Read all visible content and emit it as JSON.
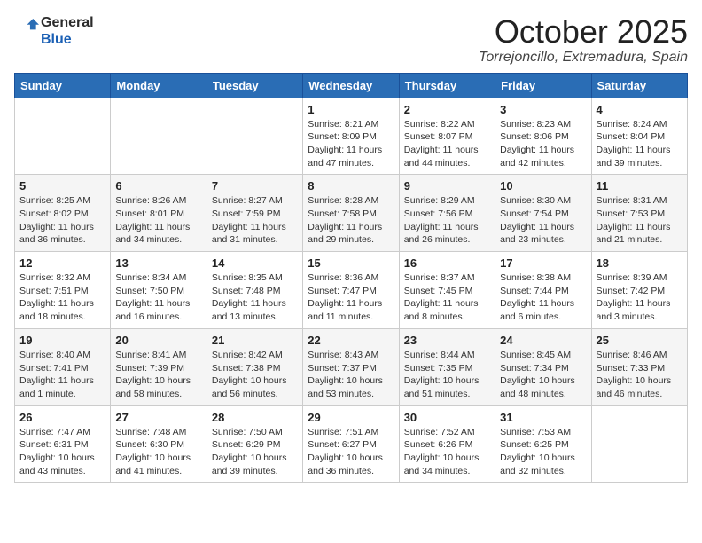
{
  "header": {
    "logo_text_general": "General",
    "logo_text_blue": "Blue",
    "month": "October 2025",
    "location": "Torrejoncillo, Extremadura, Spain"
  },
  "weekdays": [
    "Sunday",
    "Monday",
    "Tuesday",
    "Wednesday",
    "Thursday",
    "Friday",
    "Saturday"
  ],
  "weeks": [
    [
      {
        "day": "",
        "info": ""
      },
      {
        "day": "",
        "info": ""
      },
      {
        "day": "",
        "info": ""
      },
      {
        "day": "1",
        "info": "Sunrise: 8:21 AM\nSunset: 8:09 PM\nDaylight: 11 hours and 47 minutes."
      },
      {
        "day": "2",
        "info": "Sunrise: 8:22 AM\nSunset: 8:07 PM\nDaylight: 11 hours and 44 minutes."
      },
      {
        "day": "3",
        "info": "Sunrise: 8:23 AM\nSunset: 8:06 PM\nDaylight: 11 hours and 42 minutes."
      },
      {
        "day": "4",
        "info": "Sunrise: 8:24 AM\nSunset: 8:04 PM\nDaylight: 11 hours and 39 minutes."
      }
    ],
    [
      {
        "day": "5",
        "info": "Sunrise: 8:25 AM\nSunset: 8:02 PM\nDaylight: 11 hours and 36 minutes."
      },
      {
        "day": "6",
        "info": "Sunrise: 8:26 AM\nSunset: 8:01 PM\nDaylight: 11 hours and 34 minutes."
      },
      {
        "day": "7",
        "info": "Sunrise: 8:27 AM\nSunset: 7:59 PM\nDaylight: 11 hours and 31 minutes."
      },
      {
        "day": "8",
        "info": "Sunrise: 8:28 AM\nSunset: 7:58 PM\nDaylight: 11 hours and 29 minutes."
      },
      {
        "day": "9",
        "info": "Sunrise: 8:29 AM\nSunset: 7:56 PM\nDaylight: 11 hours and 26 minutes."
      },
      {
        "day": "10",
        "info": "Sunrise: 8:30 AM\nSunset: 7:54 PM\nDaylight: 11 hours and 23 minutes."
      },
      {
        "day": "11",
        "info": "Sunrise: 8:31 AM\nSunset: 7:53 PM\nDaylight: 11 hours and 21 minutes."
      }
    ],
    [
      {
        "day": "12",
        "info": "Sunrise: 8:32 AM\nSunset: 7:51 PM\nDaylight: 11 hours and 18 minutes."
      },
      {
        "day": "13",
        "info": "Sunrise: 8:34 AM\nSunset: 7:50 PM\nDaylight: 11 hours and 16 minutes."
      },
      {
        "day": "14",
        "info": "Sunrise: 8:35 AM\nSunset: 7:48 PM\nDaylight: 11 hours and 13 minutes."
      },
      {
        "day": "15",
        "info": "Sunrise: 8:36 AM\nSunset: 7:47 PM\nDaylight: 11 hours and 11 minutes."
      },
      {
        "day": "16",
        "info": "Sunrise: 8:37 AM\nSunset: 7:45 PM\nDaylight: 11 hours and 8 minutes."
      },
      {
        "day": "17",
        "info": "Sunrise: 8:38 AM\nSunset: 7:44 PM\nDaylight: 11 hours and 6 minutes."
      },
      {
        "day": "18",
        "info": "Sunrise: 8:39 AM\nSunset: 7:42 PM\nDaylight: 11 hours and 3 minutes."
      }
    ],
    [
      {
        "day": "19",
        "info": "Sunrise: 8:40 AM\nSunset: 7:41 PM\nDaylight: 11 hours and 1 minute."
      },
      {
        "day": "20",
        "info": "Sunrise: 8:41 AM\nSunset: 7:39 PM\nDaylight: 10 hours and 58 minutes."
      },
      {
        "day": "21",
        "info": "Sunrise: 8:42 AM\nSunset: 7:38 PM\nDaylight: 10 hours and 56 minutes."
      },
      {
        "day": "22",
        "info": "Sunrise: 8:43 AM\nSunset: 7:37 PM\nDaylight: 10 hours and 53 minutes."
      },
      {
        "day": "23",
        "info": "Sunrise: 8:44 AM\nSunset: 7:35 PM\nDaylight: 10 hours and 51 minutes."
      },
      {
        "day": "24",
        "info": "Sunrise: 8:45 AM\nSunset: 7:34 PM\nDaylight: 10 hours and 48 minutes."
      },
      {
        "day": "25",
        "info": "Sunrise: 8:46 AM\nSunset: 7:33 PM\nDaylight: 10 hours and 46 minutes."
      }
    ],
    [
      {
        "day": "26",
        "info": "Sunrise: 7:47 AM\nSunset: 6:31 PM\nDaylight: 10 hours and 43 minutes."
      },
      {
        "day": "27",
        "info": "Sunrise: 7:48 AM\nSunset: 6:30 PM\nDaylight: 10 hours and 41 minutes."
      },
      {
        "day": "28",
        "info": "Sunrise: 7:50 AM\nSunset: 6:29 PM\nDaylight: 10 hours and 39 minutes."
      },
      {
        "day": "29",
        "info": "Sunrise: 7:51 AM\nSunset: 6:27 PM\nDaylight: 10 hours and 36 minutes."
      },
      {
        "day": "30",
        "info": "Sunrise: 7:52 AM\nSunset: 6:26 PM\nDaylight: 10 hours and 34 minutes."
      },
      {
        "day": "31",
        "info": "Sunrise: 7:53 AM\nSunset: 6:25 PM\nDaylight: 10 hours and 32 minutes."
      },
      {
        "day": "",
        "info": ""
      }
    ]
  ]
}
